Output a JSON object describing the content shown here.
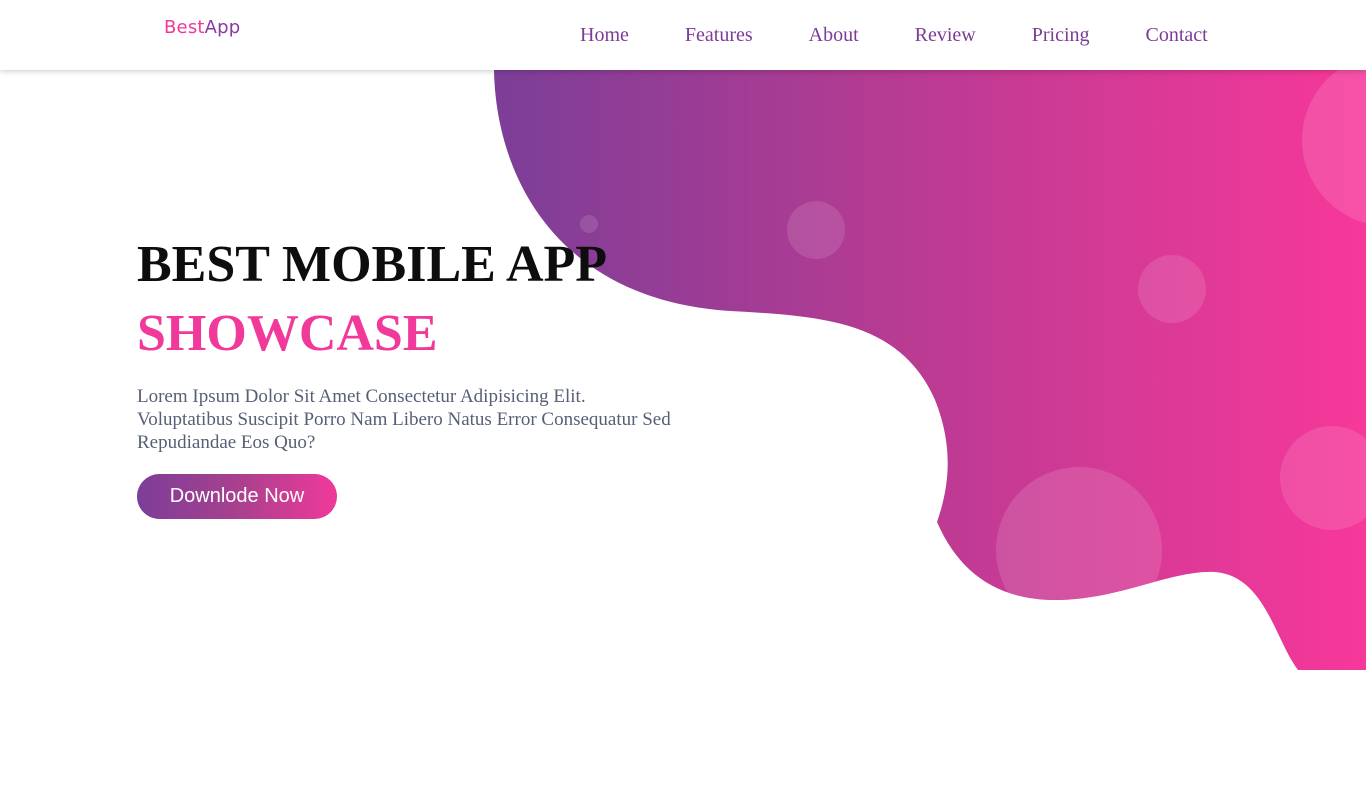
{
  "header": {
    "logo": {
      "part1": "Best",
      "part2": "App"
    },
    "nav": [
      {
        "label": "Home"
      },
      {
        "label": "Features"
      },
      {
        "label": "About"
      },
      {
        "label": "Review"
      },
      {
        "label": "Pricing"
      },
      {
        "label": "Contact"
      }
    ]
  },
  "hero": {
    "title_line1": "BEST MOBILE APP",
    "title_line2": "SHOWCASE",
    "description": "Lorem Ipsum Dolor Sit Amet Consectetur Adipisicing Elit. Voluptatibus Suscipit Porro Nam Libero Natus Error Consequatur Sed Repudiandae Eos Quo?",
    "cta_label": "Downlode Now"
  },
  "colors": {
    "accent_pink": "#f0399a",
    "accent_purple": "#7c3e98",
    "nav_text": "#7b3b96",
    "body_text": "#575f76",
    "heading_text": "#0d0d0d"
  }
}
